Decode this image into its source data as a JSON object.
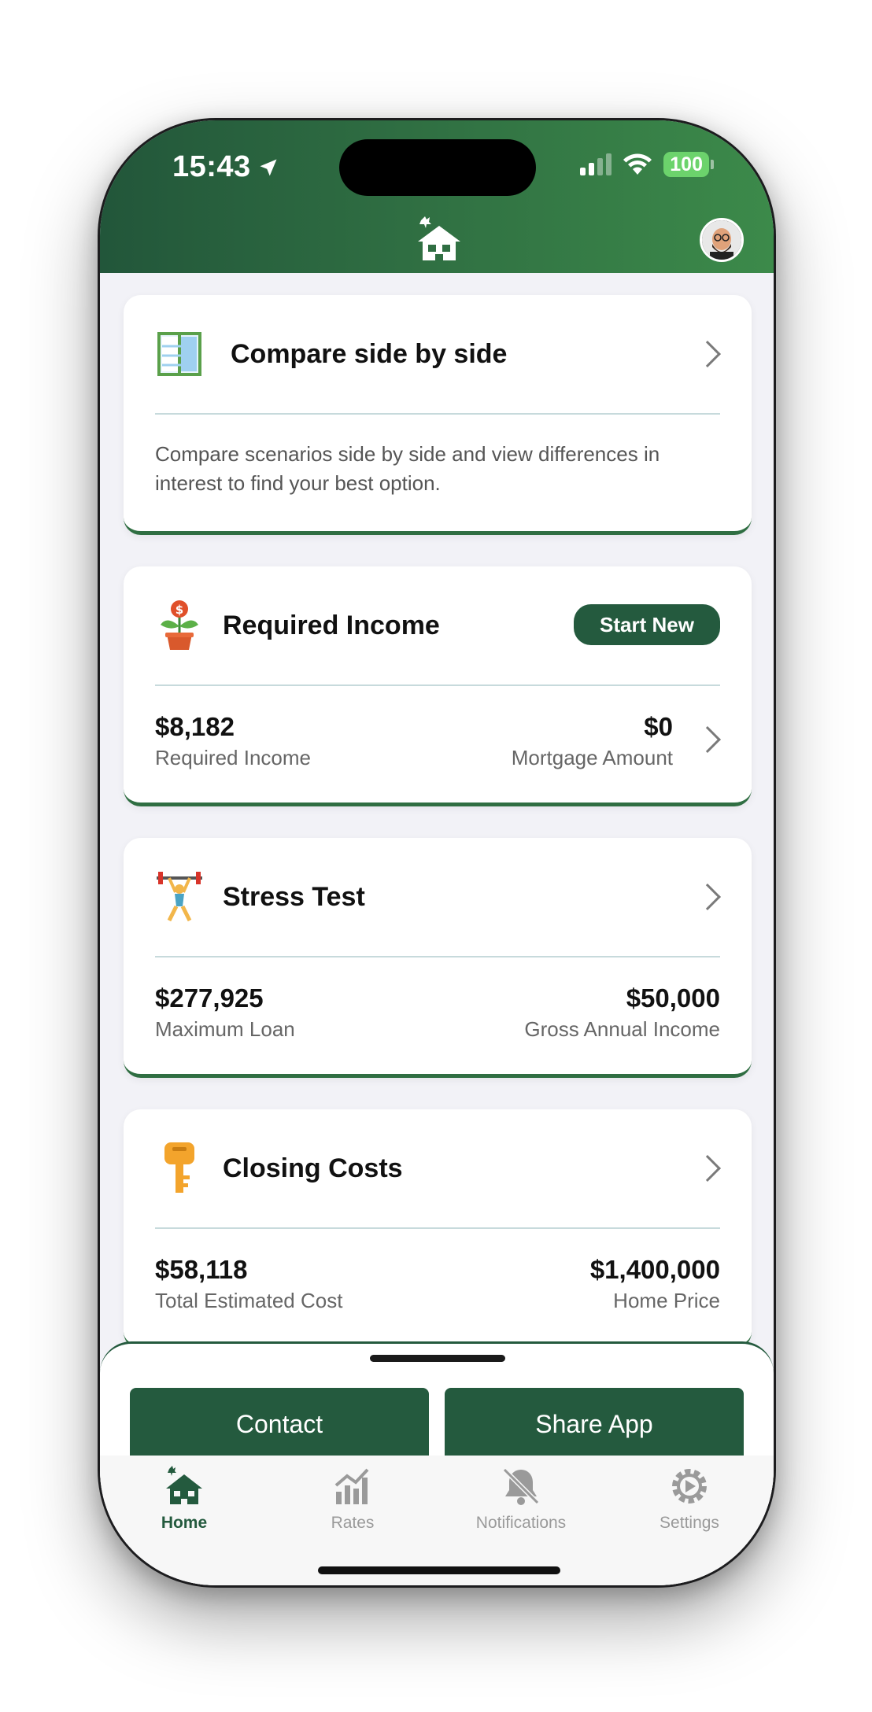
{
  "status_bar": {
    "time": "15:43",
    "battery": "100"
  },
  "cards": {
    "compare": {
      "title": "Compare side by side",
      "description": "Compare scenarios side by side and view differences in interest to find your best option."
    },
    "required_income": {
      "title": "Required Income",
      "start_new": "Start New",
      "left_value": "$8,182",
      "left_label": "Required Income",
      "right_value": "$0",
      "right_label": "Mortgage Amount"
    },
    "stress_test": {
      "title": "Stress Test",
      "left_value": "$277,925",
      "left_label": "Maximum Loan",
      "right_value": "$50,000",
      "right_label": "Gross Annual Income"
    },
    "closing_costs": {
      "title": "Closing Costs",
      "left_value": "$58,118",
      "left_label": "Total Estimated Cost",
      "right_value": "$1,400,000",
      "right_label": "Home Price"
    }
  },
  "bottom_sheet": {
    "contact": "Contact",
    "share": "Share App"
  },
  "tabs": [
    {
      "label": "Home",
      "icon": "home-icon",
      "active": true
    },
    {
      "label": "Rates",
      "icon": "chart-icon",
      "active": false
    },
    {
      "label": "Notifications",
      "icon": "bell-slash-icon",
      "active": false
    },
    {
      "label": "Settings",
      "icon": "gear-icon",
      "active": false
    }
  ],
  "colors": {
    "brand": "#245a3e",
    "accent": "#3c8a4a",
    "divider": "#c7dadc"
  }
}
